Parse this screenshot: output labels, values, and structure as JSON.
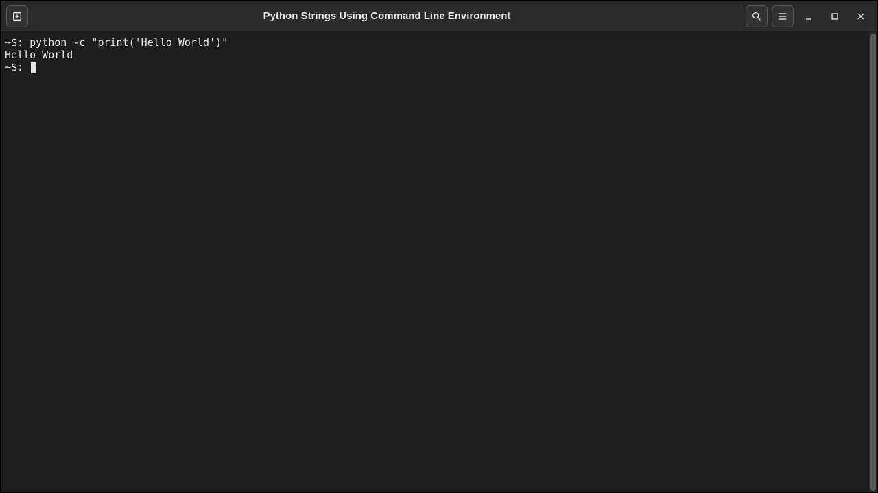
{
  "titlebar": {
    "title": "Python Strings Using Command Line Environment"
  },
  "terminal": {
    "lines": [
      {
        "prompt": "~$:",
        "cmd": " python -c \"print('Hello World')\""
      },
      {
        "output": "Hello World"
      },
      {
        "prompt": "~$:",
        "cmd": " "
      }
    ]
  }
}
